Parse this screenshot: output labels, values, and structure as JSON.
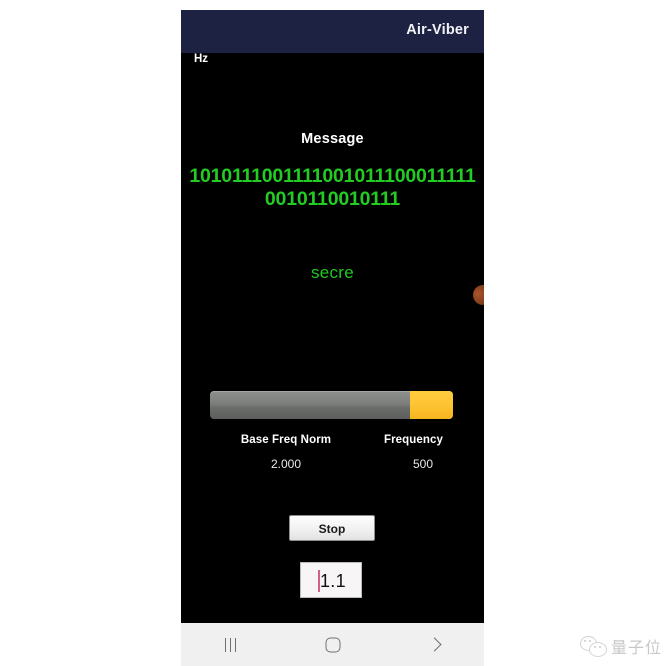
{
  "watermark": {
    "text": "量子位",
    "logo_icon": "wechat-icon"
  },
  "phone": {
    "appbar": {
      "title": "Air-Viber"
    },
    "screen": {
      "message_label": "Message",
      "bitstream": "101011100111100101110001111100101100101 11",
      "bitstream_line1": "10101110011110010111",
      "bitstream_line2": "00011111001011001011",
      "bitstream_line3": "1",
      "decoded_text": "secre",
      "slider": {
        "name": "amplitude-slider",
        "value_fraction": 0.82,
        "track_color": "#7c7f7c",
        "thumb_color": "#fdc231"
      },
      "readouts": [
        {
          "label": "Base Freq Norm",
          "value": "2.000",
          "unit": ""
        },
        {
          "label": "Frequency",
          "value": "500",
          "unit": "Hz"
        }
      ],
      "stop_button_label": "Stop",
      "number_field": {
        "value": "1.1",
        "caret_color": "#d1608c"
      },
      "accent_green": "#22cc22",
      "background": "#000000"
    },
    "navbar": {
      "recents_icon": "recents-icon",
      "home_icon": "home-icon",
      "back_icon": "back-chevron-icon"
    }
  }
}
